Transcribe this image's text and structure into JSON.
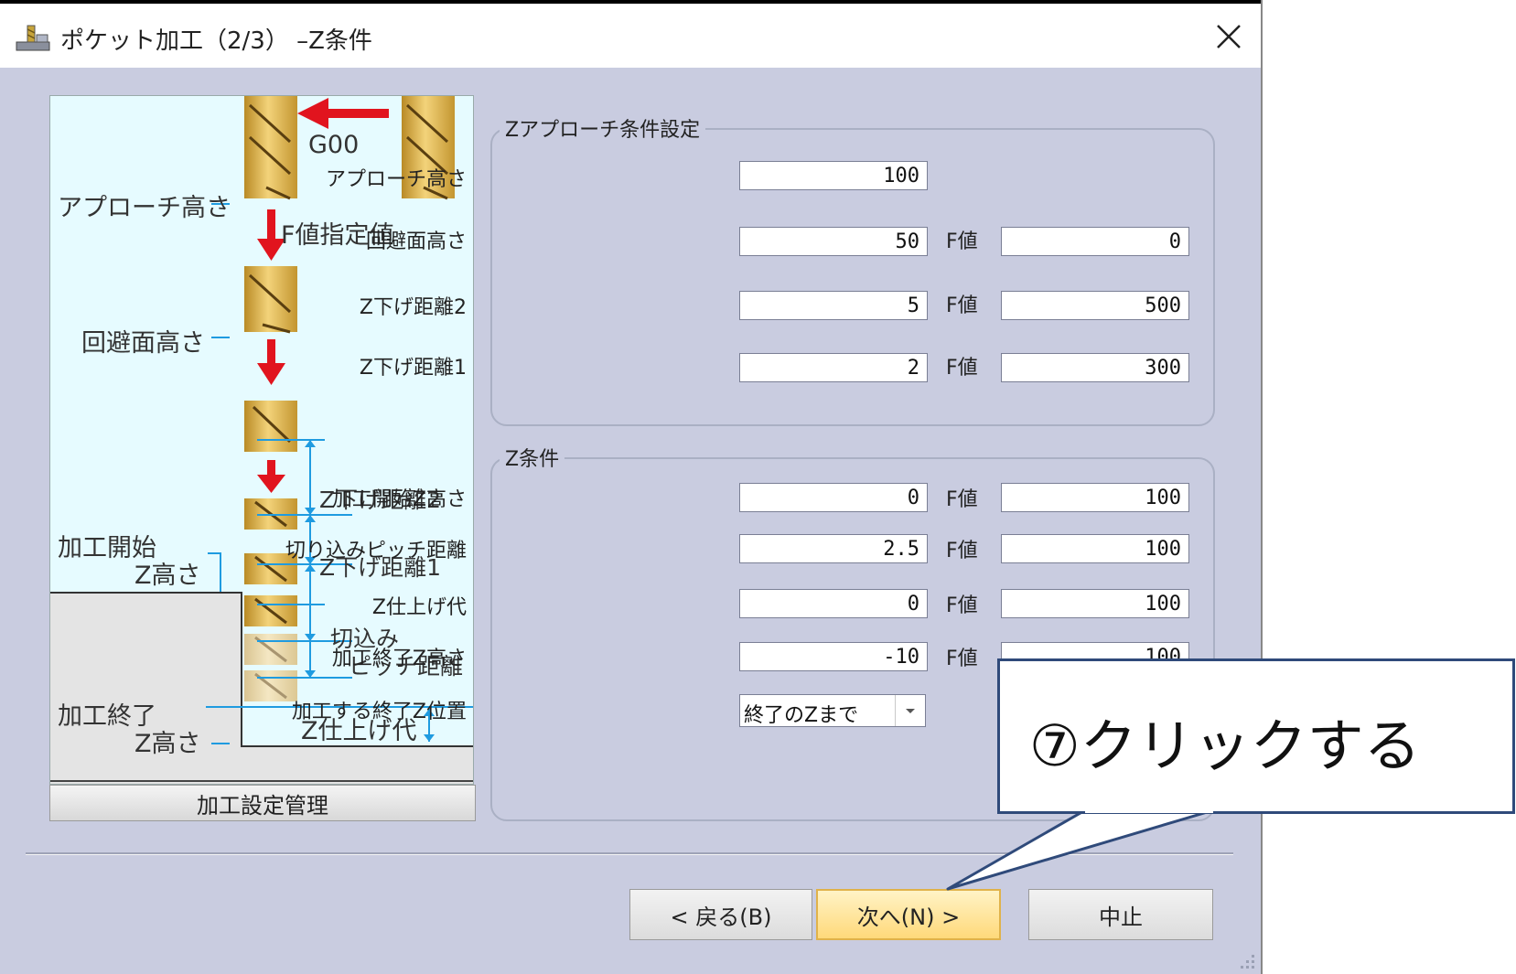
{
  "window": {
    "title": "ポケット加工（2/3）  –Z条件",
    "close_glyph": "✕"
  },
  "diagram": {
    "g00_label": "G00",
    "approach_height": "アプローチ高さ",
    "f_value": "F値指定値",
    "avoid_height": "回避面高さ",
    "z_down_2": "Z下げ距離2",
    "z_down_1": "Z下げ距離1",
    "start_z_line1": "加工開始",
    "start_z_line2": "Z高さ",
    "cut_pitch_line1": "切込み",
    "cut_pitch_line2": "ピッチ距離",
    "end_z_line1": "加工終了",
    "end_z_line2": "Z高さ",
    "finish_allowance": "Z仕上げ代",
    "manage_button": "加工設定管理"
  },
  "approach_group": {
    "title": "Zアプローチ条件設定",
    "f_label": "F値",
    "rows": [
      {
        "label": "アプローチ高さ",
        "value": "100"
      },
      {
        "label": "回避面高さ",
        "value": "50",
        "f": "0"
      },
      {
        "label": "Z下げ距離2",
        "value": "5",
        "f": "500"
      },
      {
        "label": "Z下げ距離1",
        "value": "2",
        "f": "300"
      }
    ]
  },
  "z_group": {
    "title": "Z条件",
    "f_label": "F値",
    "rows": [
      {
        "label": "加工開始Z高さ",
        "value": "0",
        "f": "100"
      },
      {
        "label": "切り込みピッチ距離",
        "value": "2.5",
        "f": "100"
      },
      {
        "label": "Z仕上げ代",
        "value": "0",
        "f": "100"
      },
      {
        "label": "加工終了Z高さ",
        "value": "-10",
        "f": "100"
      }
    ],
    "end_position_label": "加工する終了Z位置",
    "end_position_value": "終了のZまで"
  },
  "buttons": {
    "back": "< 戻る(B)",
    "next": "次へ(N) >",
    "cancel": "中止"
  },
  "callout": {
    "text": "⑦クリックする"
  },
  "colors": {
    "dialog_bg": "#c9cce0",
    "diagram_bg": "#e6fbff",
    "arrow_red": "#e1141e",
    "dim_blue": "#1f9be0",
    "next_button": "#ffd97a",
    "callout_border": "#2f4a7a"
  }
}
